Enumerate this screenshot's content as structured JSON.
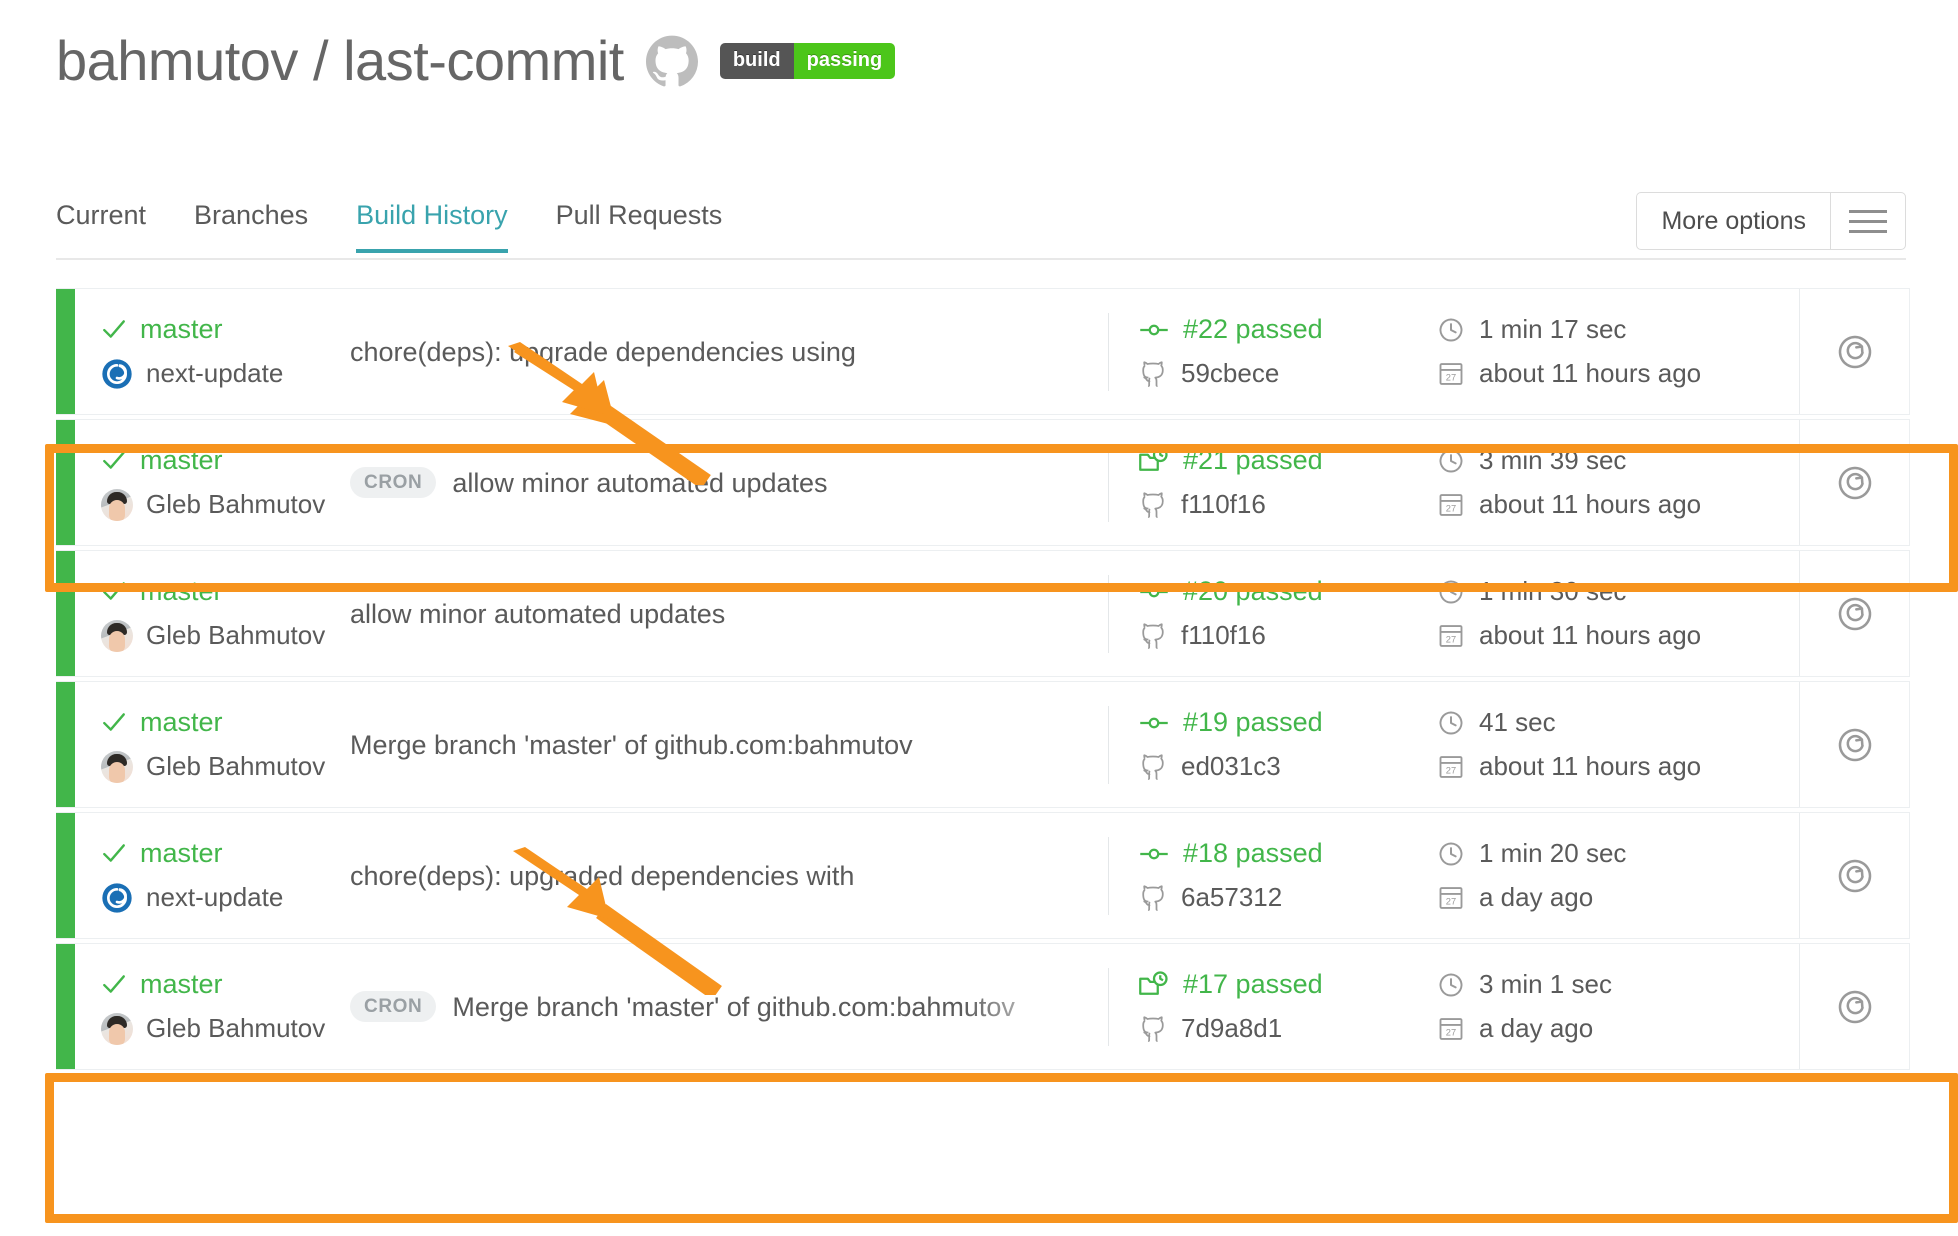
{
  "header": {
    "owner": "bahmutov",
    "separator": "/",
    "repo": "last-commit",
    "title": "bahmutov / last-commit",
    "github_icon": "github-icon",
    "badge": {
      "left_label": "build",
      "right_label": "passing",
      "left_color": "#555555",
      "right_color": "#4cc61a"
    }
  },
  "tabs": [
    {
      "label": "Current",
      "active": false
    },
    {
      "label": "Branches",
      "active": false
    },
    {
      "label": "Build History",
      "active": true
    },
    {
      "label": "Pull Requests",
      "active": false
    }
  ],
  "more_options": {
    "label": "More options",
    "icon": "hamburger-icon"
  },
  "colors": {
    "accent_teal": "#39a3ad",
    "pass_green": "#42b64a",
    "annotation_orange": "#f7941e",
    "text_gray": "#5a5a5a"
  },
  "builds": [
    {
      "status": "passed",
      "branch": "master",
      "trigger_badge": null,
      "committer": "next-update",
      "committer_icon": "next-update-icon",
      "message": "chore(deps): upgrade dependencies using",
      "build_icon": "commit-icon",
      "build_number": "#22 passed",
      "sha": "59cbece",
      "duration": "1 min 17 sec",
      "finished": "about 11 hours ago",
      "restart_icon": "restart-icon",
      "highlighted": false
    },
    {
      "status": "passed",
      "branch": "master",
      "trigger_badge": "CRON",
      "committer": "Gleb Bahmutov",
      "committer_icon": "avatar",
      "message": "allow minor automated updates",
      "build_icon": "cron-build-icon",
      "build_number": "#21 passed",
      "sha": "f110f16",
      "duration": "3 min 39 sec",
      "finished": "about 11 hours ago",
      "restart_icon": "restart-icon",
      "highlighted": true
    },
    {
      "status": "passed",
      "branch": "master",
      "trigger_badge": null,
      "committer": "Gleb Bahmutov",
      "committer_icon": "avatar",
      "message": "allow minor automated updates",
      "build_icon": "commit-icon",
      "build_number": "#20 passed",
      "sha": "f110f16",
      "duration": "1 min 30 sec",
      "finished": "about 11 hours ago",
      "restart_icon": "restart-icon",
      "highlighted": false
    },
    {
      "status": "passed",
      "branch": "master",
      "trigger_badge": null,
      "committer": "Gleb Bahmutov",
      "committer_icon": "avatar",
      "message": "Merge branch 'master' of github.com:bahmutov",
      "build_icon": "commit-icon",
      "build_number": "#19 passed",
      "sha": "ed031c3",
      "duration": "41 sec",
      "finished": "about 11 hours ago",
      "restart_icon": "restart-icon",
      "highlighted": false
    },
    {
      "status": "passed",
      "branch": "master",
      "trigger_badge": null,
      "committer": "next-update",
      "committer_icon": "next-update-icon",
      "message": "chore(deps): upgraded dependencies with",
      "build_icon": "commit-icon",
      "build_number": "#18 passed",
      "sha": "6a57312",
      "duration": "1 min 20 sec",
      "finished": "a day ago",
      "restart_icon": "restart-icon",
      "highlighted": false
    },
    {
      "status": "passed",
      "branch": "master",
      "trigger_badge": "CRON",
      "committer": "Gleb Bahmutov",
      "committer_icon": "avatar",
      "message": "Merge branch 'master' of github.com:bahmutov",
      "build_icon": "cron-build-icon",
      "build_number": "#17 passed",
      "sha": "7d9a8d1",
      "duration": "3 min 1 sec",
      "finished": "a day ago",
      "restart_icon": "restart-icon",
      "highlighted": true
    }
  ],
  "annotations": {
    "color": "#f7941e",
    "arrows": [
      {
        "name": "arrow-to-row-22-message"
      },
      {
        "name": "arrow-to-row-18-message"
      }
    ],
    "highlight_boxes": [
      {
        "name": "highlight-box-build-21"
      },
      {
        "name": "highlight-box-build-17"
      }
    ]
  }
}
